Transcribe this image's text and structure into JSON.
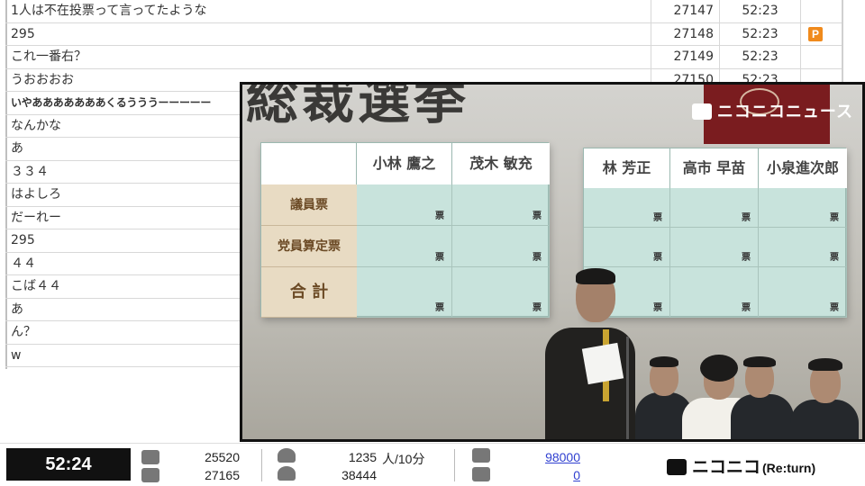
{
  "comments": [
    {
      "text": "1人は不在投票って言ってたような",
      "no": "27147",
      "time": "52:23",
      "badge": ""
    },
    {
      "text": "295",
      "no": "27148",
      "time": "52:23",
      "badge": "P"
    },
    {
      "text": "これ一番右？",
      "no": "27149",
      "time": "52:23",
      "badge": ""
    },
    {
      "text": "うおおおお",
      "no": "27150",
      "time": "52:23",
      "badge": ""
    },
    {
      "text": "いやあああああああくるうううーーーーー",
      "no": "",
      "time": "",
      "badge": ""
    },
    {
      "text": "なんかな",
      "no": "",
      "time": "",
      "badge": ""
    },
    {
      "text": "あ",
      "no": "",
      "time": "",
      "badge": ""
    },
    {
      "text": "３３４",
      "no": "",
      "time": "",
      "badge": ""
    },
    {
      "text": "はよしろ",
      "no": "",
      "time": "",
      "badge": ""
    },
    {
      "text": "だーれー",
      "no": "",
      "time": "",
      "badge": ""
    },
    {
      "text": "295",
      "no": "",
      "time": "",
      "badge": ""
    },
    {
      "text": "４４",
      "no": "",
      "time": "",
      "badge": ""
    },
    {
      "text": "こば４４",
      "no": "",
      "time": "",
      "badge": ""
    },
    {
      "text": "あ",
      "no": "",
      "time": "",
      "badge": ""
    },
    {
      "text": "ん？",
      "no": "",
      "time": "",
      "badge": ""
    },
    {
      "text": "w",
      "no": "",
      "time": "",
      "badge": ""
    }
  ],
  "video": {
    "headline": "総裁選挙",
    "channel": "ニコニコニュース",
    "board_left": {
      "candidates": [
        "小林 鷹之",
        "茂木 敏充"
      ],
      "rows": [
        "議員票",
        "党員算定票",
        "合 計"
      ],
      "unit": "票"
    },
    "board_right": {
      "candidates": [
        "林 芳正",
        "高市 早苗",
        "小泉進次郎"
      ],
      "unit": "票"
    }
  },
  "status": {
    "clock": "52:24",
    "comment_stat_1": "25520",
    "comment_stat_2": "27165",
    "viewers_rate": "1235",
    "viewers_rate_unit": "人/10分",
    "viewers_total": "38444",
    "ad_points": "98000",
    "gift_points": "0",
    "logo": "ニコニコ",
    "logo_sub": "(Re:turn)"
  },
  "colors": {
    "badge_premium": "#f08a1c",
    "link": "#2f3fd0",
    "board": "#c8e3dc",
    "banner_red": "#7a1c1f"
  },
  "icons": [
    "comment-icon",
    "comment-stack-icon",
    "viewer-icon",
    "viewer-total-icon",
    "megaphone-icon",
    "gift-icon",
    "tv-icon"
  ]
}
